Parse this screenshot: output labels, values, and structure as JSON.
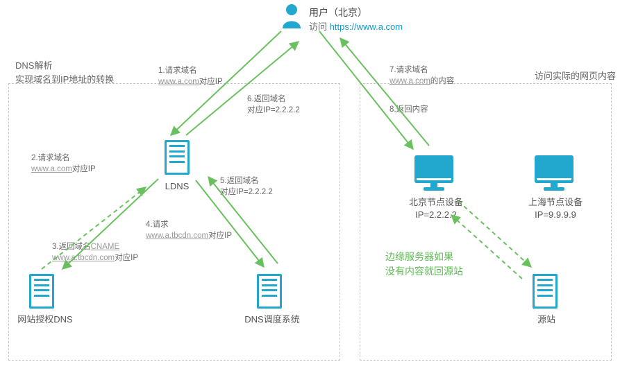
{
  "user": {
    "title": "用户（北京）",
    "visit_label": "访问",
    "visit_url": "https://www.a.com"
  },
  "left_panel": {
    "title_line1": "DNS解析",
    "title_line2": "实现域名到IP地址的转换",
    "ldns_label": "LDNS",
    "auth_dns_label": "网站授权DNS",
    "dns_sched_label": "DNS调度系统"
  },
  "right_panel": {
    "title": "访问实际的网页内容",
    "beijing_node_label": "北京节点设备",
    "beijing_node_ip": "IP=2.2.2.2",
    "shanghai_node_label": "上海节点设备",
    "shanghai_node_ip": "IP=9.9.9.9",
    "origin_label": "源站",
    "note_line1": "边缘服务器如果",
    "note_line2": "没有内容就回源站"
  },
  "steps": {
    "s1_pre": "1.请求域名",
    "s1_link": "www.a.com",
    "s1_post": "对应IP",
    "s2_pre": "2.请求域名",
    "s2_link": "www.a.com",
    "s2_post": "对应IP",
    "s3_pre": "3.返回域名",
    "s3_link1": "CNAME",
    "s3_link2": "www.a.tbcdn.com",
    "s3_post": "对应IP",
    "s4_pre": "4.请求",
    "s4_link": "www.a.tbcdn.com",
    "s4_post": "对应IP",
    "s5_pre": "5.返回域名",
    "s5_post": "对应IP=2.2.2.2",
    "s6_pre": "6.返回域名",
    "s6_post": "对应IP=2.2.2.2",
    "s7_pre": "7.请求域名",
    "s7_link": "www.a.com",
    "s7_post": "的内容",
    "s8": "8.返回内容"
  }
}
